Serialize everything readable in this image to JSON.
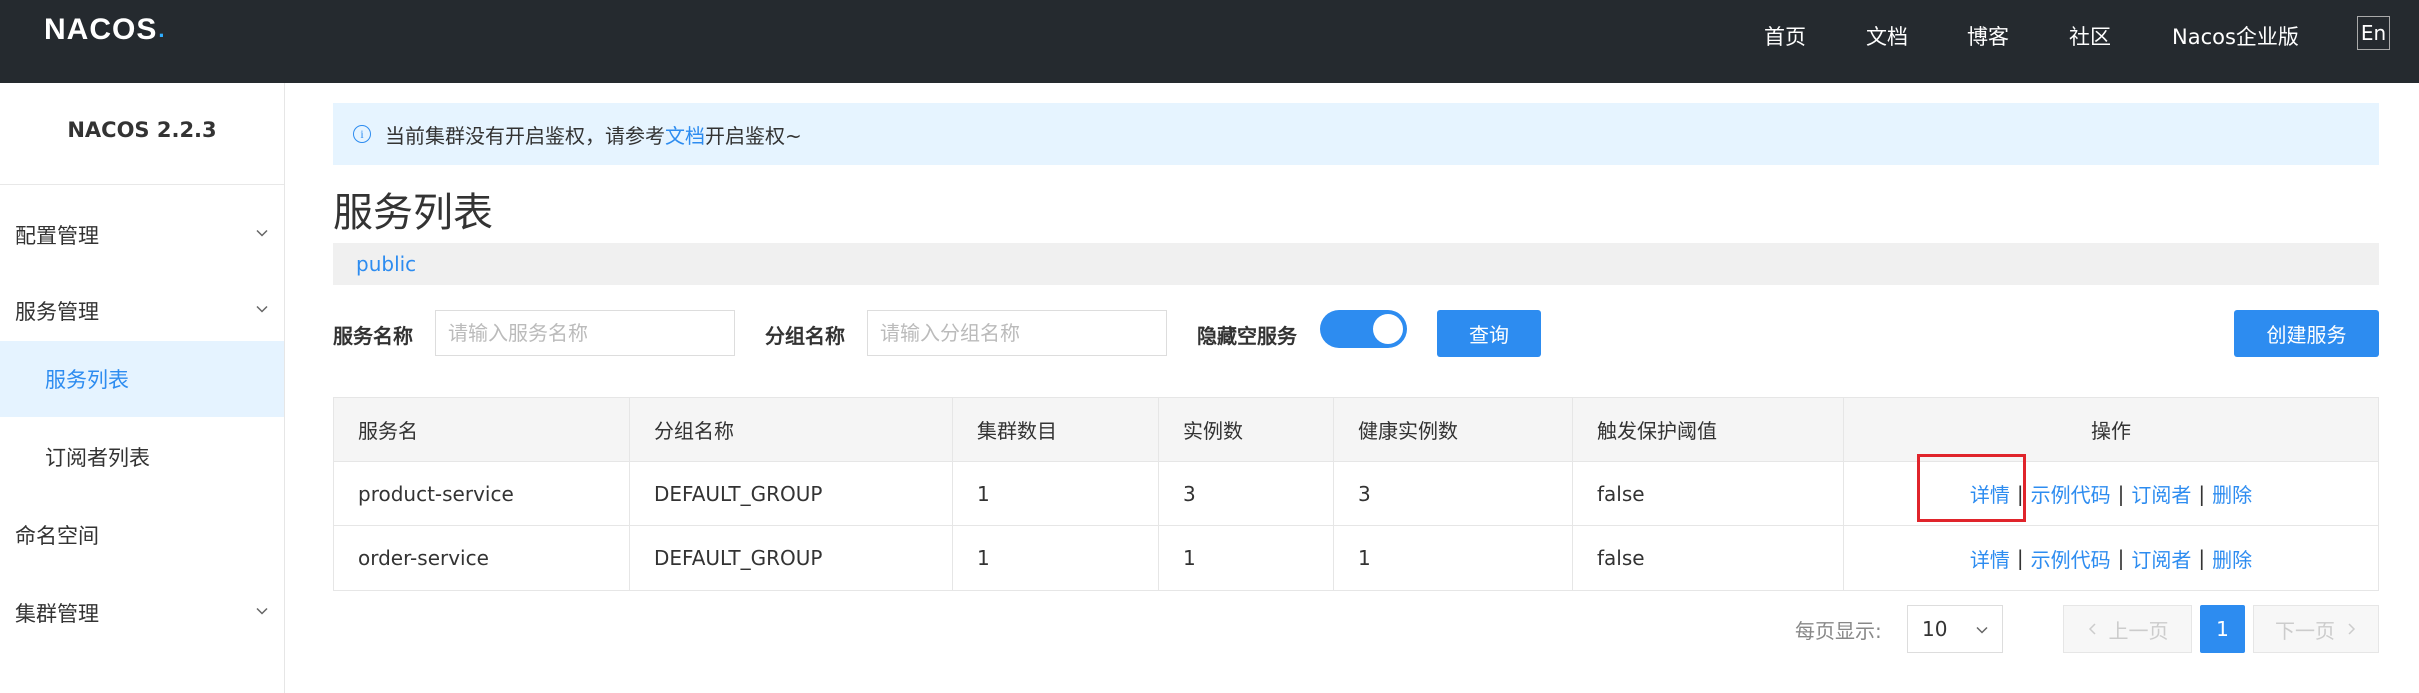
{
  "header": {
    "logo_text": "NACOS",
    "nav": [
      "首页",
      "文档",
      "博客",
      "社区",
      "Nacos企业版"
    ],
    "lang_button": "En"
  },
  "sidebar": {
    "version": "NACOS 2.2.3",
    "items": [
      {
        "label": "配置管理"
      },
      {
        "label": "服务管理"
      },
      {
        "label": "服务列表"
      },
      {
        "label": "订阅者列表"
      },
      {
        "label": "命名空间"
      },
      {
        "label": "集群管理"
      }
    ]
  },
  "notice": {
    "text_before": "当前集群没有开启鉴权，请参考",
    "link": "文档",
    "text_after": "开启鉴权~"
  },
  "page": {
    "title": "服务列表",
    "namespace": "public"
  },
  "filters": {
    "service_name_label": "服务名称",
    "service_name_placeholder": "请输入服务名称",
    "group_name_label": "分组名称",
    "group_name_placeholder": "请输入分组名称",
    "hide_empty_label": "隐藏空服务",
    "hide_empty_enabled": true,
    "query_button": "查询",
    "create_button": "创建服务"
  },
  "table": {
    "columns": [
      "服务名",
      "分组名称",
      "集群数目",
      "实例数",
      "健康实例数",
      "触发保护阈值",
      "操作"
    ],
    "rows": [
      [
        "product-service",
        "DEFAULT_GROUP",
        "1",
        "3",
        "3",
        "false"
      ],
      [
        "order-service",
        "DEFAULT_GROUP",
        "1",
        "1",
        "1",
        "false"
      ]
    ],
    "actions": [
      "详情",
      "示例代码",
      "订阅者",
      "删除"
    ],
    "separator": "|"
  },
  "pagination": {
    "page_size_label": "每页显示:",
    "page_size": "10",
    "prev": "上一页",
    "next": "下一页",
    "current_page": "1"
  },
  "colors": {
    "topbar": "#252a2f",
    "accent": "#2d8cf0",
    "highlight": "#e0242b"
  }
}
